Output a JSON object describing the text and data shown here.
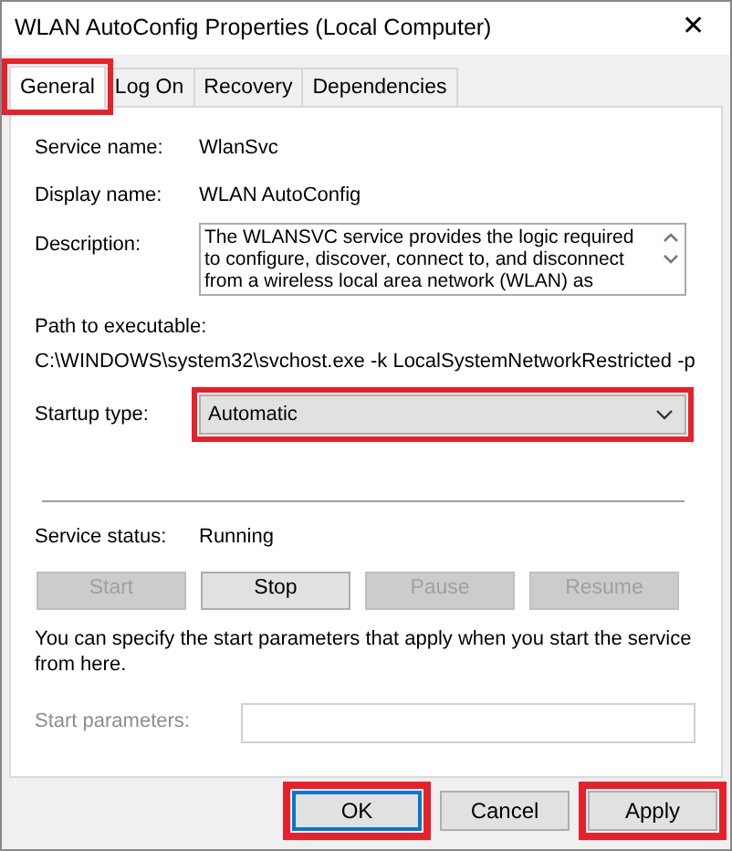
{
  "window": {
    "title": "WLAN AutoConfig Properties (Local Computer)",
    "close": "✕"
  },
  "tabs": [
    {
      "label": "General",
      "selected": true,
      "highlighted": true
    },
    {
      "label": "Log On",
      "selected": false,
      "highlighted": false
    },
    {
      "label": "Recovery",
      "selected": false,
      "highlighted": false
    },
    {
      "label": "Dependencies",
      "selected": false,
      "highlighted": false
    }
  ],
  "fields": [
    {
      "label": "Service name:",
      "value": "WlanSvc"
    },
    {
      "label": "Display name:",
      "value": "WLAN AutoConfig"
    }
  ],
  "description": {
    "label": "Description:",
    "value": "The WLANSVC service provides the logic required to configure, discover, connect to, and disconnect from a wireless local area network (WLAN) as"
  },
  "path": {
    "label": "Path to executable:",
    "value": "C:\\WINDOWS\\system32\\svchost.exe -k LocalSystemNetworkRestricted -p"
  },
  "startup_type": {
    "label": "Startup type:",
    "value": "Automatic",
    "highlighted": true
  },
  "service_status": {
    "label": "Service status:",
    "value": "Running"
  },
  "service_buttons": [
    {
      "label": "Start",
      "disabled": true
    },
    {
      "label": "Stop",
      "disabled": false
    },
    {
      "label": "Pause",
      "disabled": true
    },
    {
      "label": "Resume",
      "disabled": true
    }
  ],
  "hint": "You can specify the start parameters that apply when you start the service from here.",
  "start_parameters": {
    "label": "Start parameters:",
    "disabled": true
  },
  "dialog_buttons": [
    {
      "label": "OK",
      "default": true,
      "highlighted": true
    },
    {
      "label": "Cancel",
      "default": false,
      "highlighted": false
    },
    {
      "label": "Apply",
      "default": false,
      "highlighted": true
    }
  ]
}
